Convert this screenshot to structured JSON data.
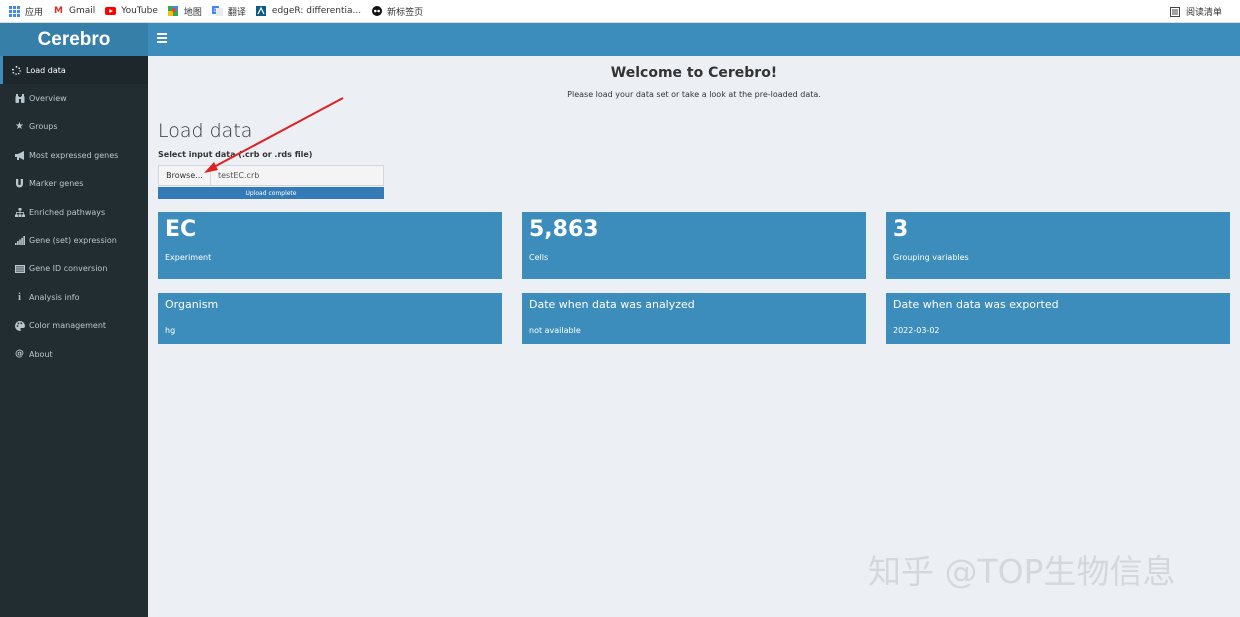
{
  "bookmarks": {
    "items": [
      {
        "label": "应用",
        "icon": "apps-icon"
      },
      {
        "label": "Gmail",
        "icon": "gmail-icon"
      },
      {
        "label": "YouTube",
        "icon": "youtube-icon"
      },
      {
        "label": "地图",
        "icon": "maps-icon"
      },
      {
        "label": "翻译",
        "icon": "translate-icon"
      },
      {
        "label": "edgeR: differentia...",
        "icon": "bookmark-page-icon"
      },
      {
        "label": "新标签页",
        "icon": "new-tab-icon"
      }
    ],
    "reading_list": "阅读清单"
  },
  "app": {
    "title": "Cerebro",
    "accent": "#3c8dbc",
    "sidebar_bg": "#222d32"
  },
  "sidebar": {
    "items": [
      {
        "label": "Load data",
        "icon": "spinner-icon",
        "active": true
      },
      {
        "label": "Overview",
        "icon": "binoculars-icon"
      },
      {
        "label": "Groups",
        "icon": "star-icon"
      },
      {
        "label": "Most expressed genes",
        "icon": "bullhorn-icon"
      },
      {
        "label": "Marker genes",
        "icon": "magnet-icon"
      },
      {
        "label": "Enriched pathways",
        "icon": "sitemap-icon"
      },
      {
        "label": "Gene (set) expression",
        "icon": "signal-bars-icon"
      },
      {
        "label": "Gene ID conversion",
        "icon": "list-icon"
      },
      {
        "label": "Analysis info",
        "icon": "info-icon"
      },
      {
        "label": "Color management",
        "icon": "palette-icon"
      },
      {
        "label": "About",
        "icon": "at-icon"
      }
    ]
  },
  "main": {
    "welcome": "Welcome to Cerebro!",
    "subtitle": "Please load your data set or take a look at the pre-loaded data.",
    "section_title": "Load data",
    "input_label": "Select input data (.crb or .rds file)",
    "browse_label": "Browse...",
    "file_name": "testEC.crb",
    "progress_text": "Upload complete",
    "progress_value": 1.0,
    "info_boxes_top": [
      {
        "value": "EC",
        "label": "Experiment"
      },
      {
        "value": "5,863",
        "label": "Cells"
      },
      {
        "value": "3",
        "label": "Grouping variables"
      }
    ],
    "info_boxes_bottom": [
      {
        "title": "Organism",
        "value": "hg"
      },
      {
        "title": "Date when data was analyzed",
        "value": "not available"
      },
      {
        "title": "Date when data was exported",
        "value": "2022-03-02"
      }
    ]
  },
  "watermark": "知乎 @TOP生物信息"
}
